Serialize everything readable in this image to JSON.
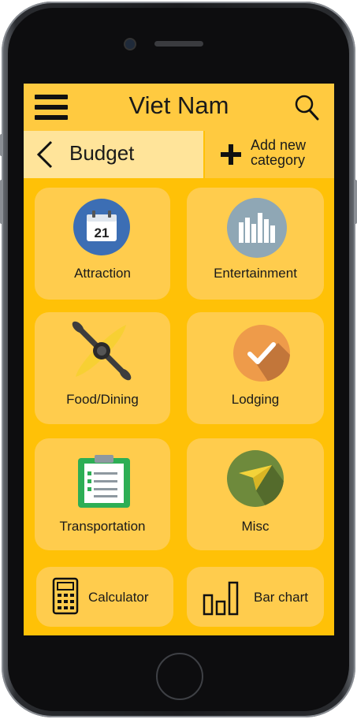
{
  "header": {
    "title": "Viet Nam"
  },
  "subheader": {
    "title": "Budget",
    "add_label_line1": "Add new",
    "add_label_line2": "category"
  },
  "tiles": [
    {
      "label": "Attraction",
      "icon": "calendar-icon",
      "calendar_day": "21"
    },
    {
      "label": "Entertainment",
      "icon": "bar-graph-icon"
    },
    {
      "label": "Food/Dining",
      "icon": "kayak-paddle-icon"
    },
    {
      "label": "Lodging",
      "icon": "check-icon"
    },
    {
      "label": "Transportation",
      "icon": "clipboard-icon"
    },
    {
      "label": "Misc",
      "icon": "paper-plane-icon"
    }
  ],
  "bottom": [
    {
      "label": "Calculator",
      "icon": "calculator-icon"
    },
    {
      "label": "Bar chart",
      "icon": "bar-chart-icon"
    }
  ],
  "colors": {
    "screen_bg": "#FFC107",
    "tile": "#FFCC4D",
    "topbar": "#FFCA40",
    "back_area": "#FFE49A"
  }
}
